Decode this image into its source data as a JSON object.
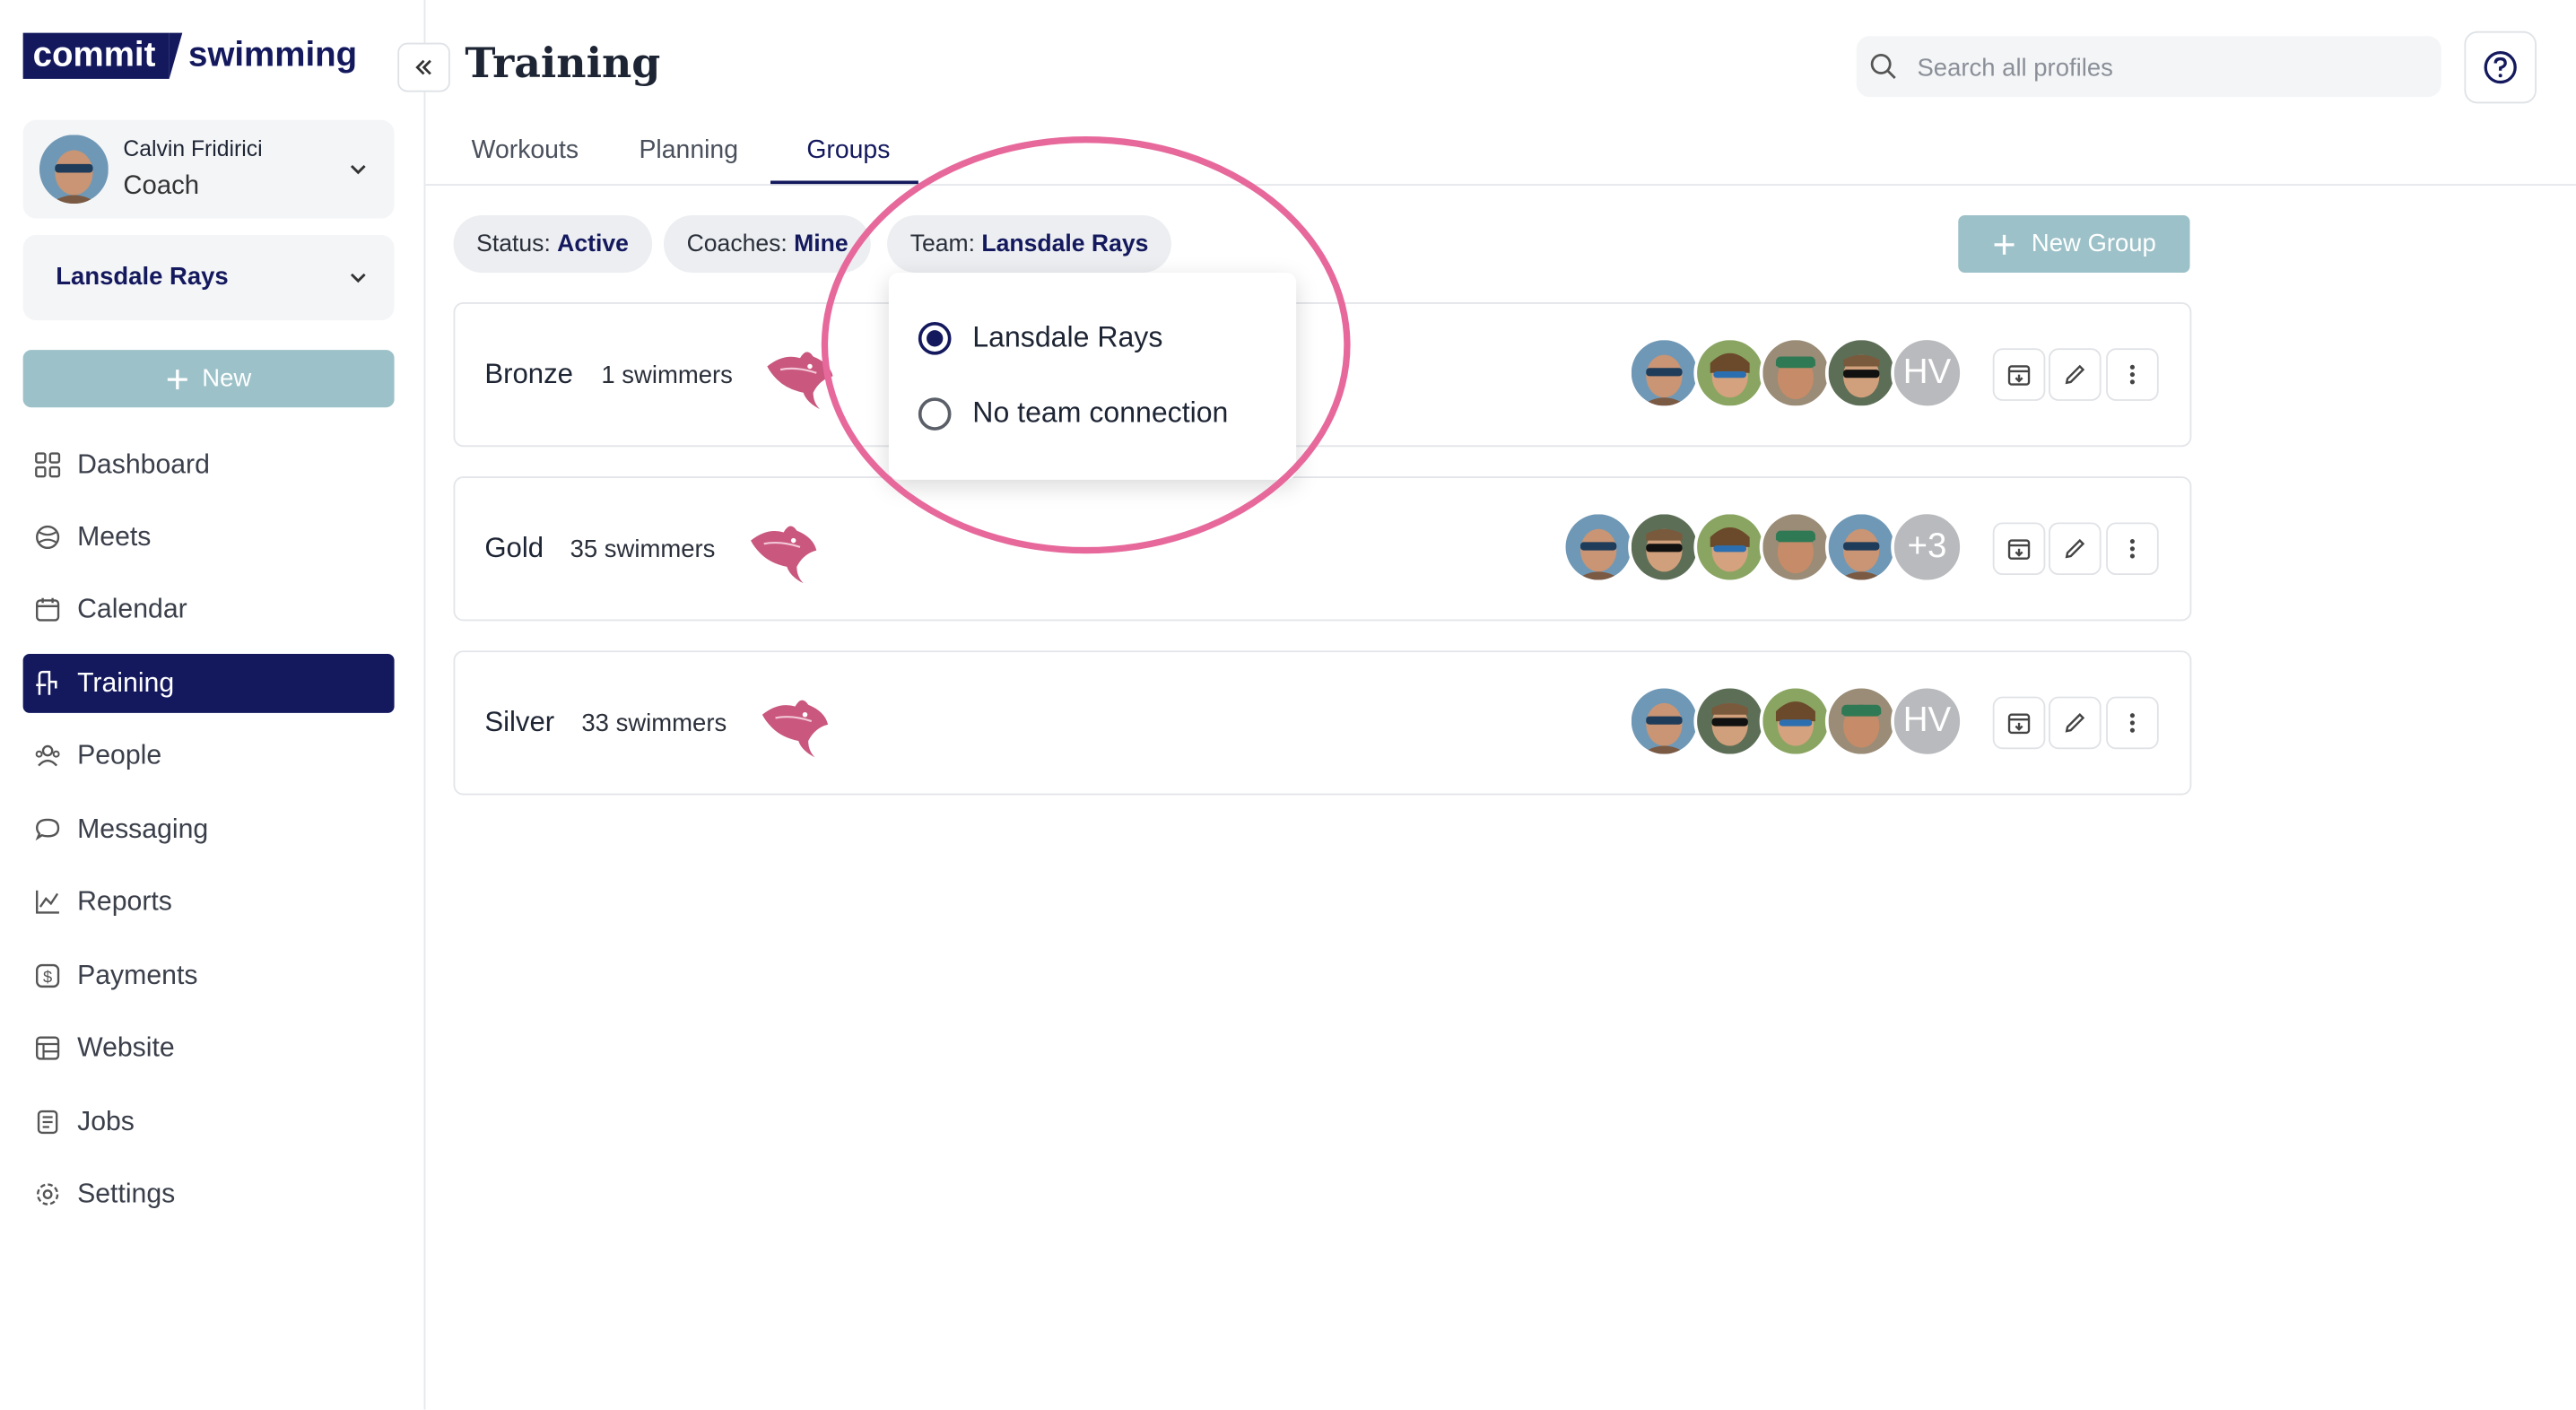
{
  "app": {
    "logo_part1": "commit",
    "logo_part2": "swimming"
  },
  "user": {
    "name": "Calvin Fridirici",
    "role": "Coach"
  },
  "team": {
    "name": "Lansdale Rays"
  },
  "sidebar": {
    "new_label": "New",
    "items": [
      {
        "label": "Dashboard",
        "icon": "dashboard-icon"
      },
      {
        "label": "Meets",
        "icon": "meets-icon"
      },
      {
        "label": "Calendar",
        "icon": "calendar-icon"
      },
      {
        "label": "Training",
        "icon": "training-icon",
        "active": true
      },
      {
        "label": "People",
        "icon": "people-icon"
      },
      {
        "label": "Messaging",
        "icon": "messaging-icon"
      },
      {
        "label": "Reports",
        "icon": "reports-icon"
      },
      {
        "label": "Payments",
        "icon": "payments-icon"
      },
      {
        "label": "Website",
        "icon": "website-icon"
      },
      {
        "label": "Jobs",
        "icon": "jobs-icon"
      },
      {
        "label": "Settings",
        "icon": "settings-icon"
      }
    ]
  },
  "header": {
    "title": "Training",
    "search_placeholder": "Search all profiles"
  },
  "tabs": [
    {
      "label": "Workouts"
    },
    {
      "label": "Planning"
    },
    {
      "label": "Groups",
      "active": true
    }
  ],
  "filters": {
    "status": {
      "key": "Status:",
      "value": "Active"
    },
    "coaches": {
      "key": "Coaches:",
      "value": "Mine"
    },
    "team": {
      "key": "Team:",
      "value": "Lansdale Rays"
    }
  },
  "new_group_label": "New Group",
  "team_dropdown": {
    "options": [
      {
        "label": "Lansdale Rays",
        "selected": true
      },
      {
        "label": "No team connection",
        "selected": false
      }
    ]
  },
  "groups": [
    {
      "name": "Bronze",
      "count": "1 swimmers",
      "overflow": "HV"
    },
    {
      "name": "Gold",
      "count": "35 swimmers",
      "overflow": "+3"
    },
    {
      "name": "Silver",
      "count": "33 swimmers",
      "overflow": "HV"
    }
  ],
  "colors": {
    "brand": "#14195e",
    "accent_button": "#9cc1c8",
    "highlight": "#e7699c",
    "team_logo": "#c9577e"
  }
}
